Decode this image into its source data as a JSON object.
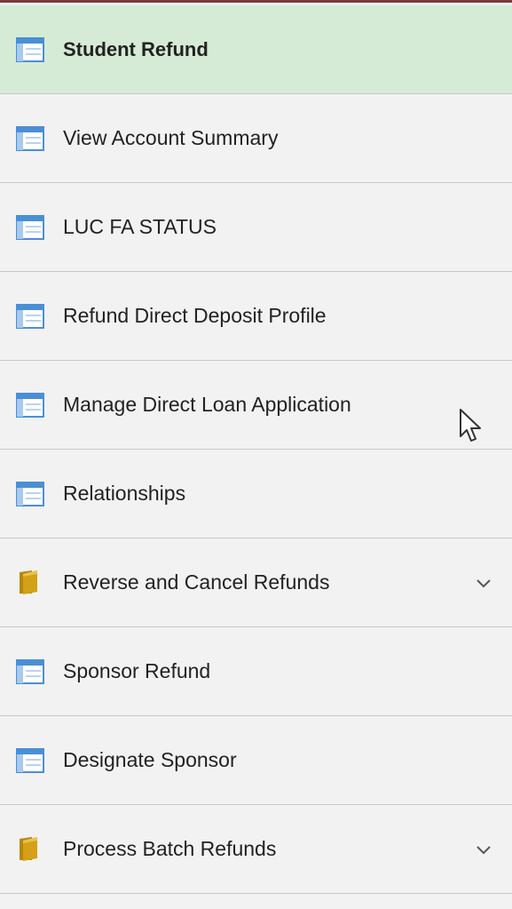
{
  "nav": {
    "items": [
      {
        "label": "Student Refund",
        "icon": "page-icon",
        "selected": true,
        "expandable": false
      },
      {
        "label": "View Account Summary",
        "icon": "page-icon",
        "selected": false,
        "expandable": false
      },
      {
        "label": "LUC FA STATUS",
        "icon": "page-icon",
        "selected": false,
        "expandable": false
      },
      {
        "label": "Refund Direct Deposit Profile",
        "icon": "page-icon",
        "selected": false,
        "expandable": false
      },
      {
        "label": "Manage Direct Loan Application",
        "icon": "page-icon",
        "selected": false,
        "expandable": false
      },
      {
        "label": "Relationships",
        "icon": "page-icon",
        "selected": false,
        "expandable": false
      },
      {
        "label": "Reverse and Cancel Refunds",
        "icon": "folder-icon",
        "selected": false,
        "expandable": true
      },
      {
        "label": "Sponsor Refund",
        "icon": "page-icon",
        "selected": false,
        "expandable": false
      },
      {
        "label": "Designate Sponsor",
        "icon": "page-icon",
        "selected": false,
        "expandable": false
      },
      {
        "label": "Process Batch Refunds",
        "icon": "folder-icon",
        "selected": false,
        "expandable": true
      }
    ]
  },
  "colors": {
    "selected_bg": "#d6ebd6",
    "row_bg": "#f2f2f2",
    "divider": "#c8c8c8",
    "page_icon_blue": "#4a8fd6",
    "folder_gold": "#d4a017"
  }
}
